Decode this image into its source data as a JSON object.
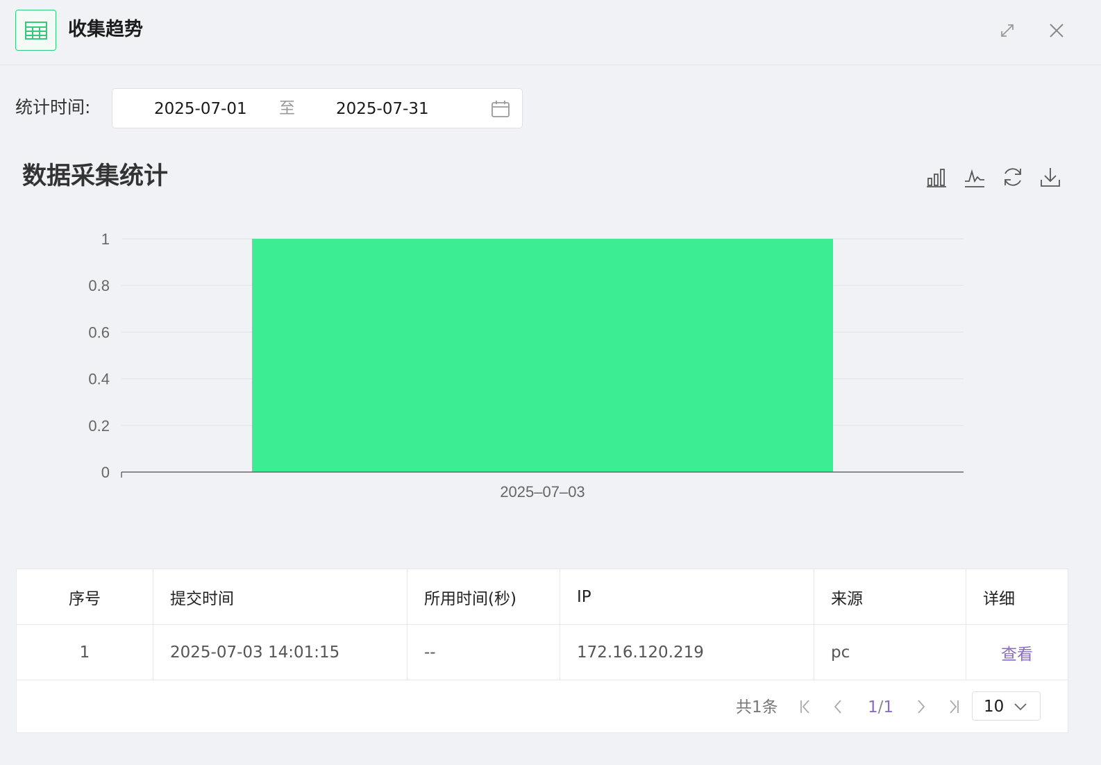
{
  "header": {
    "title": "收集趋势",
    "icon": "table-icon"
  },
  "filter": {
    "label": "统计时间:",
    "start": "2025-07-01",
    "separator": "至",
    "end": "2025-07-31"
  },
  "chart": {
    "title": "数据采集统计",
    "tools": [
      "bar-chart-icon",
      "line-chart-icon",
      "refresh-icon",
      "download-icon"
    ]
  },
  "chart_data": {
    "type": "bar",
    "categories": [
      "2025–07–03"
    ],
    "values": [
      1
    ],
    "ylim": [
      0,
      1
    ],
    "yticks": [
      "0",
      "0.2",
      "0.4",
      "0.6",
      "0.8",
      "1"
    ],
    "grid": true,
    "bar_color": "#3ded94"
  },
  "table": {
    "columns": [
      "序号",
      "提交时间",
      "所用时间(秒)",
      "IP",
      "来源",
      "详细"
    ],
    "rows": [
      {
        "index": "1",
        "submit_time": "2025-07-03 14:01:15",
        "duration": "--",
        "ip": "172.16.120.219",
        "source": "pc",
        "detail": "查看"
      }
    ]
  },
  "pagination": {
    "total": "共1条",
    "current": "1",
    "pages": "1",
    "page_size": "10"
  },
  "colors": {
    "accent": "#36c97e",
    "link": "#8a6cc0"
  }
}
